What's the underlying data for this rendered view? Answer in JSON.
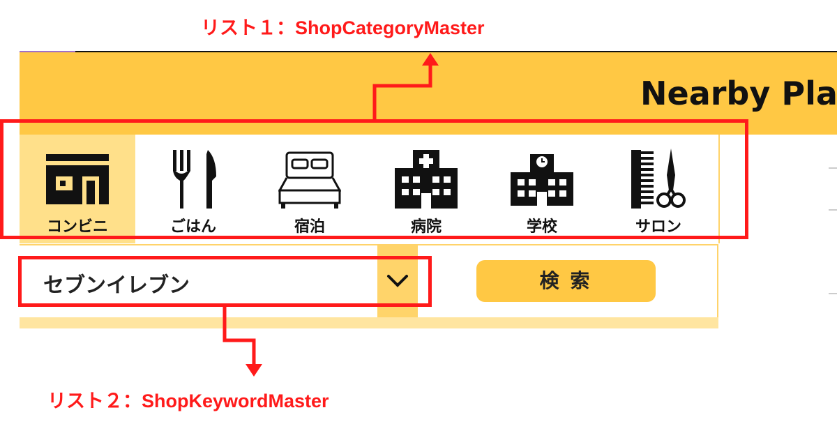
{
  "annotations": {
    "list1_label": "リスト１：ShopCategoryMaster",
    "list2_label": "リスト２：ShopKeywordMaster",
    "color": "#ff1a1a"
  },
  "header": {
    "title": "Nearby Plac",
    "bg_color": "#ffc844"
  },
  "categories": [
    {
      "label": "コンビニ",
      "icon": "convenience-store-icon",
      "selected": true
    },
    {
      "label": "ごはん",
      "icon": "fork-knife-icon",
      "selected": false
    },
    {
      "label": "宿泊",
      "icon": "bed-icon",
      "selected": false
    },
    {
      "label": "病院",
      "icon": "hospital-icon",
      "selected": false
    },
    {
      "label": "学校",
      "icon": "school-icon",
      "selected": false
    },
    {
      "label": "サロン",
      "icon": "comb-scissors-icon",
      "selected": false
    }
  ],
  "keyword_select": {
    "value": "セブンイレブン",
    "icon": "chevron-down-icon"
  },
  "search_button": {
    "label": "検 索"
  }
}
